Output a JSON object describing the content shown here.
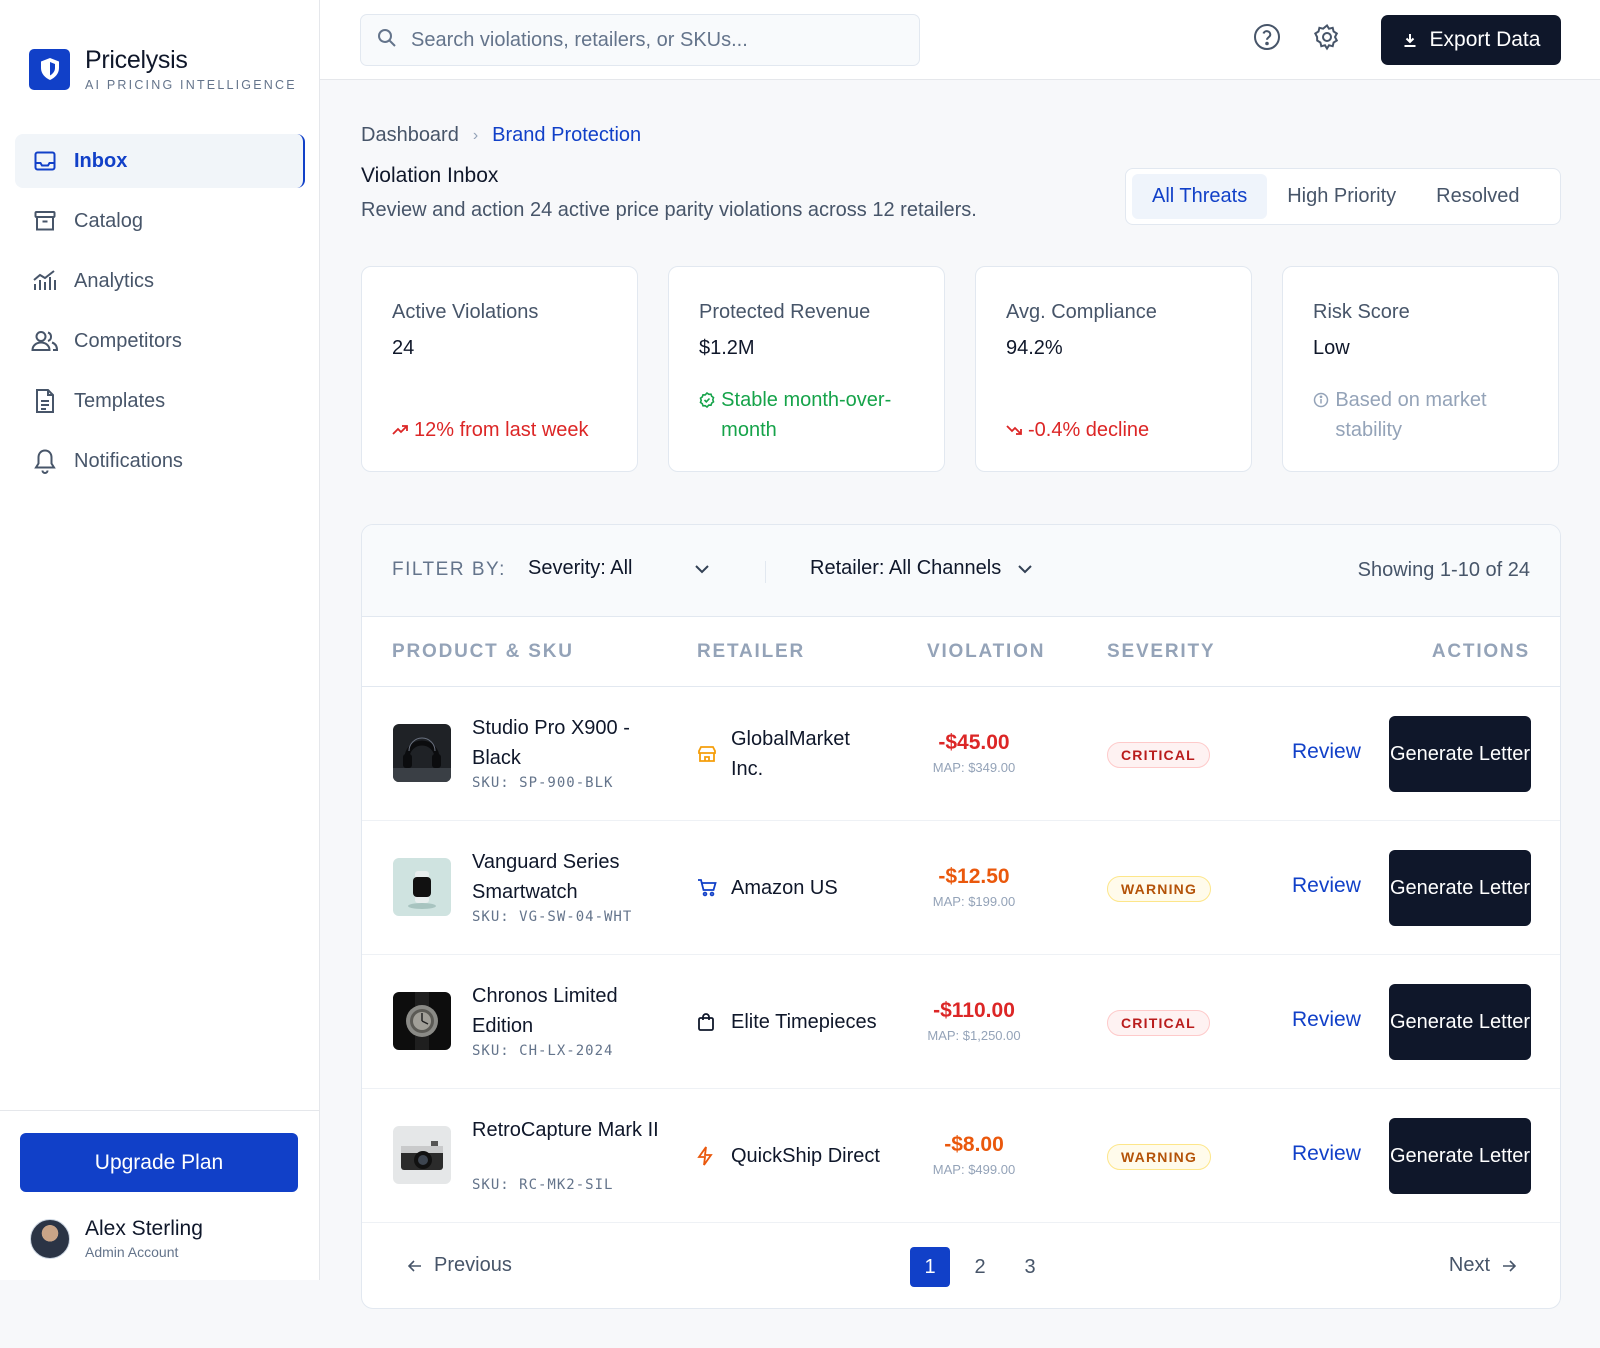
{
  "brand": {
    "name": "Pricelysis",
    "tagline": "AI PRICING INTELLIGENCE"
  },
  "nav": [
    {
      "label": "Inbox",
      "icon": "inbox-icon",
      "active": true
    },
    {
      "label": "Catalog",
      "icon": "archive-icon"
    },
    {
      "label": "Analytics",
      "icon": "chart-icon"
    },
    {
      "label": "Competitors",
      "icon": "users-icon"
    },
    {
      "label": "Templates",
      "icon": "document-icon"
    },
    {
      "label": "Notifications",
      "icon": "bell-icon"
    }
  ],
  "upgrade_label": "Upgrade Plan",
  "user": {
    "name": "Alex Sterling",
    "role": "Admin Account"
  },
  "search": {
    "placeholder": "Search violations, retailers, or SKUs..."
  },
  "export_label": "Export Data",
  "breadcrumb": {
    "parent": "Dashboard",
    "current": "Brand Protection"
  },
  "page": {
    "title": "Violation Inbox",
    "description": "Review and action 24 active price parity violations across 12 retailers."
  },
  "segments": [
    "All Threats",
    "High Priority",
    "Resolved"
  ],
  "stats": [
    {
      "label": "Active Violations",
      "value": "24",
      "note": "12% from last week",
      "tone": "red",
      "icon": "trending-up-icon"
    },
    {
      "label": "Protected Revenue",
      "value": "$1.2M",
      "note": "Stable month-over-month",
      "tone": "green",
      "icon": "check-badge-icon"
    },
    {
      "label": "Avg. Compliance",
      "value": "94.2%",
      "note": "-0.4% decline",
      "tone": "red",
      "icon": "trending-down-icon"
    },
    {
      "label": "Risk Score",
      "value": "Low",
      "note": "Based on market stability",
      "tone": "muted",
      "icon": "info-icon"
    }
  ],
  "filters": {
    "label": "FILTER BY:",
    "severity": "Severity: All",
    "retailer": "Retailer: All Channels",
    "showing": "Showing 1-10 of 24"
  },
  "table": {
    "headers": [
      "PRODUCT & SKU",
      "RETAILER",
      "VIOLATION",
      "SEVERITY",
      "ACTIONS"
    ],
    "rows": [
      {
        "name": "Studio Pro X900 - Black",
        "sku": "SKU: SP-900-BLK",
        "retailer": "GlobalMarket Inc.",
        "retailer_icon": "store-icon",
        "amount": "-$45.00",
        "map": "MAP: $349.00",
        "severity": "CRITICAL",
        "review": "Review",
        "action": "Generate Letter"
      },
      {
        "name": "Vanguard Series Smartwatch",
        "sku": "SKU: VG-SW-04-WHT",
        "retailer": "Amazon US",
        "retailer_icon": "cart-icon",
        "amount": "-$12.50",
        "map": "MAP: $199.00",
        "severity": "WARNING",
        "review": "Review",
        "action": "Generate Letter"
      },
      {
        "name": "Chronos Limited Edition",
        "sku": "SKU: CH-LX-2024",
        "retailer": "Elite Timepieces",
        "retailer_icon": "shopping-bag-icon",
        "amount": "-$110.00",
        "map": "MAP: $1,250.00",
        "severity": "CRITICAL",
        "review": "Review",
        "action": "Generate Letter"
      },
      {
        "name": "RetroCapture Mark II",
        "sku": "SKU: RC-MK2-SIL",
        "retailer": "QuickShip Direct",
        "retailer_icon": "bolt-icon",
        "amount": "-$8.00",
        "map": "MAP: $499.00",
        "severity": "WARNING",
        "review": "Review",
        "action": "Generate Letter"
      }
    ]
  },
  "pagination": {
    "previous": "Previous",
    "next": "Next",
    "pages": [
      "1",
      "2",
      "3"
    ],
    "current": "1"
  },
  "colors": {
    "accent": "#1140c8",
    "dark": "#0f172a",
    "critical": "#dc2626",
    "warning": "#ea580c",
    "success": "#16a34a"
  }
}
